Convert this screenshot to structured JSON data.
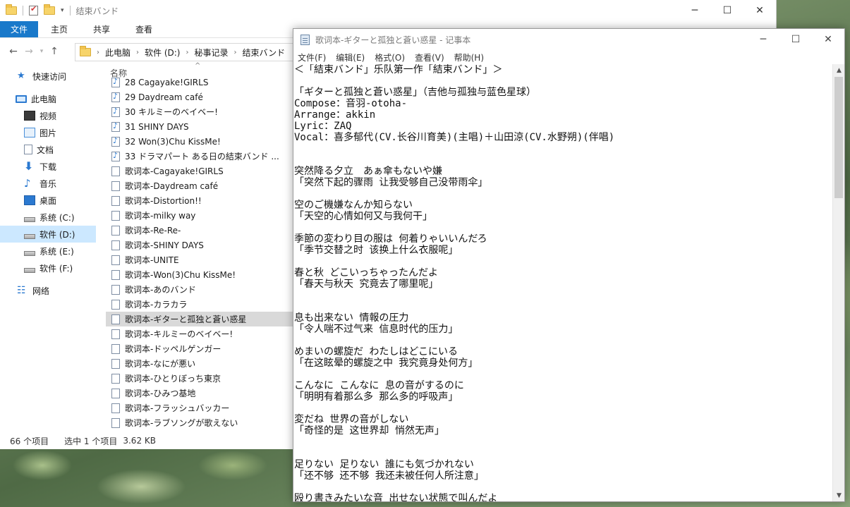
{
  "explorer": {
    "title": "结束バンド",
    "ribbon": [
      "文件",
      "主页",
      "共享",
      "查看"
    ],
    "breadcrumb": [
      "此电脑",
      "软件 (D:)",
      "秘事记录",
      "结束バンド"
    ],
    "sort_label": "名称",
    "nav": [
      {
        "label": "快速访问",
        "icon": "star-icon",
        "kind": "star"
      },
      {
        "label": "此电脑",
        "icon": "computer-icon",
        "kind": "pc"
      },
      {
        "label": "视频",
        "icon": "video-icon",
        "kind": "video"
      },
      {
        "label": "图片",
        "icon": "picture-icon",
        "kind": "pic"
      },
      {
        "label": "文档",
        "icon": "document-icon",
        "kind": "doc"
      },
      {
        "label": "下载",
        "icon": "download-icon",
        "kind": "down"
      },
      {
        "label": "音乐",
        "icon": "music-icon",
        "kind": "music"
      },
      {
        "label": "桌面",
        "icon": "desktop-icon",
        "kind": "desk"
      },
      {
        "label": "系统 (C:)",
        "icon": "drive-icon",
        "kind": "drive"
      },
      {
        "label": "软件 (D:)",
        "icon": "drive-icon",
        "kind": "drive",
        "selected": true
      },
      {
        "label": "系统 (E:)",
        "icon": "drive-icon",
        "kind": "drive"
      },
      {
        "label": "软件 (F:)",
        "icon": "drive-icon",
        "kind": "drive"
      },
      {
        "label": "网络",
        "icon": "network-icon",
        "kind": "net"
      }
    ],
    "files": [
      {
        "name": "28 Cagayake!GIRLS",
        "type": "audio"
      },
      {
        "name": "29 Daydream café",
        "type": "audio"
      },
      {
        "name": "30 キルミーのベイベー!",
        "type": "audio"
      },
      {
        "name": "31 SHINY DAYS",
        "type": "audio"
      },
      {
        "name": "32 Won(3)Chu KissMe!",
        "type": "audio"
      },
      {
        "name": "33 ドラマパート ある日の結束バンド ...",
        "type": "audio"
      },
      {
        "name": "歌词本-Cagayake!GIRLS",
        "type": "text"
      },
      {
        "name": "歌词本-Daydream café",
        "type": "text"
      },
      {
        "name": "歌词本-Distortion!!",
        "type": "text"
      },
      {
        "name": "歌词本-milky way",
        "type": "text"
      },
      {
        "name": "歌词本-Re-Re-",
        "type": "text"
      },
      {
        "name": "歌词本-SHINY DAYS",
        "type": "text"
      },
      {
        "name": "歌词本-UNITE",
        "type": "text"
      },
      {
        "name": "歌词本-Won(3)Chu KissMe!",
        "type": "text"
      },
      {
        "name": "歌词本-あのバンド",
        "type": "text"
      },
      {
        "name": "歌词本-カラカラ",
        "type": "text"
      },
      {
        "name": "歌词本-ギターと孤独と蒼い惑星",
        "type": "text",
        "selected": true
      },
      {
        "name": "歌词本-キルミーのベイベー!",
        "type": "text"
      },
      {
        "name": "歌词本-ドッペルゲンガー",
        "type": "text"
      },
      {
        "name": "歌词本-なにが悪い",
        "type": "text"
      },
      {
        "name": "歌词本-ひとりぼっち東京",
        "type": "text"
      },
      {
        "name": "歌词本-ひみつ基地",
        "type": "text"
      },
      {
        "name": "歌词本-フラッシュバッカー",
        "type": "text"
      },
      {
        "name": "歌词本-ラブソングが歌えない",
        "type": "text"
      }
    ],
    "status": {
      "count": "66 个项目",
      "selected": "选中 1 个项目",
      "size": "3.62 KB"
    }
  },
  "notepad": {
    "title": "歌词本-ギターと孤独と蒼い惑星 - 记事本",
    "menu": [
      "文件(F)",
      "编辑(E)",
      "格式(O)",
      "查看(V)",
      "帮助(H)"
    ],
    "lines": [
      "＜「結束バンド」乐队第一作「結束バンド」＞",
      "",
      "「ギターと孤独と蒼い惑星」（吉他与孤独与蓝色星球）",
      "Compose：音羽-otoha-",
      "Arrange：akkin",
      "Lyric：ZAQ",
      "Vocal：喜多郁代(CV.长谷川育美)(主唱)＋山田涼(CV.水野朔)(伴唱)",
      "",
      "",
      "突然降る夕立　あぁ傘もないや嫌",
      "「突然下起的骤雨 让我受够自己没带雨伞」",
      "",
      "空のご機嫌なんか知らない",
      "「天空的心情如何又与我何干」",
      "",
      "季節の変わり目の服は 何着りゃいいんだろ",
      "「季节交替之时 该换上什么衣服呢」",
      "",
      "春と秋 どこいっちゃったんだよ",
      "「春天与秋天 究竟去了哪里呢」",
      "",
      "",
      "息も出来ない 情報の圧力",
      "「令人喘不过气来 信息时代的压力」",
      "",
      "めまいの螺旋だ わたしはどこにいる",
      "「在这眩晕的螺旋之中 我究竟身处何方」",
      "",
      "こんなに こんなに 息の音がするのに",
      "「明明有着那么多 那么多的呼吸声」",
      "",
      "変だね 世界の音がしない",
      "「奇怪的是 这世界却 悄然无声」",
      "",
      "",
      "足りない 足りない 誰にも気づかれない",
      "「还不够 还不够 我还未被任何人所注意」",
      "",
      "殴り書きみたいな音 出せない状態で叫んだよ"
    ]
  }
}
